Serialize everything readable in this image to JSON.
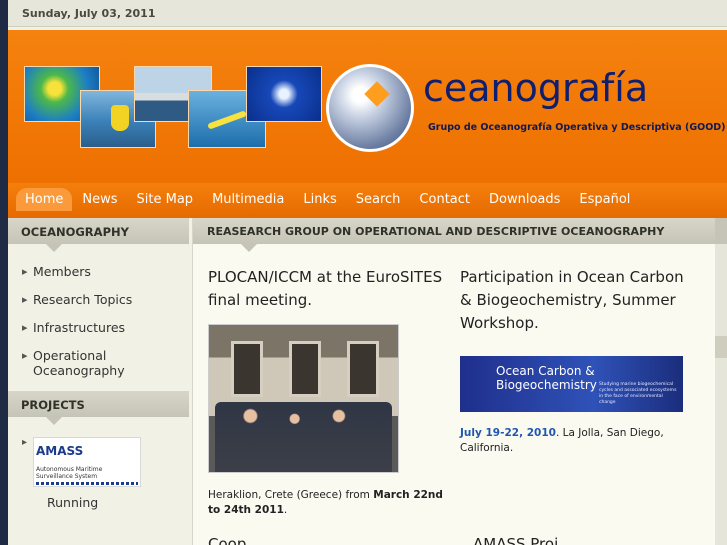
{
  "date": "Sunday, July 03, 2011",
  "banner": {
    "brand": "ceanografía",
    "subtitle": "Grupo de Oceanografía Operativa y Descriptiva (GOOD)"
  },
  "nav": {
    "items": [
      "Home",
      "News",
      "Site Map",
      "Multimedia",
      "Links",
      "Search",
      "Contact",
      "Downloads",
      "Español"
    ],
    "active": "Home"
  },
  "sidebar": {
    "oceanography_title": "OCEANOGRAPHY",
    "items": [
      "Members",
      "Research Topics",
      "Infrastructures",
      "Operational Oceanography"
    ],
    "projects_title": "PROJECTS",
    "project_logo": {
      "name": "AMASS",
      "tagline": "Autonomous Maritime Surveillance System"
    },
    "project_status": "Running"
  },
  "main": {
    "header": "REASEARCH GROUP ON OPERATIONAL AND DESCRIPTIVE OCEANOGRAPHY",
    "post1": {
      "title": "PLOCAN/ICCM at the EuroSITES final meeting.",
      "caption_prefix": "Heraklion, Crete (Greece) from ",
      "caption_date": "March 22nd to 24th 2011",
      "caption_suffix": "."
    },
    "post2": {
      "title": "Participation in Ocean Carbon & Biogeochemistry, Summer Workshop.",
      "image_title": "Ocean Carbon & Biogeochemistry",
      "image_subtitle": "Studying marine biogeochemical cycles and associated ecosystems in the face of environmental change",
      "date_highlight": "July 19-22, 2010",
      "date_rest": ". La Jolla, San Diego, California."
    },
    "next_left": "Coop...",
    "next_right": "AMASS Proj..."
  }
}
